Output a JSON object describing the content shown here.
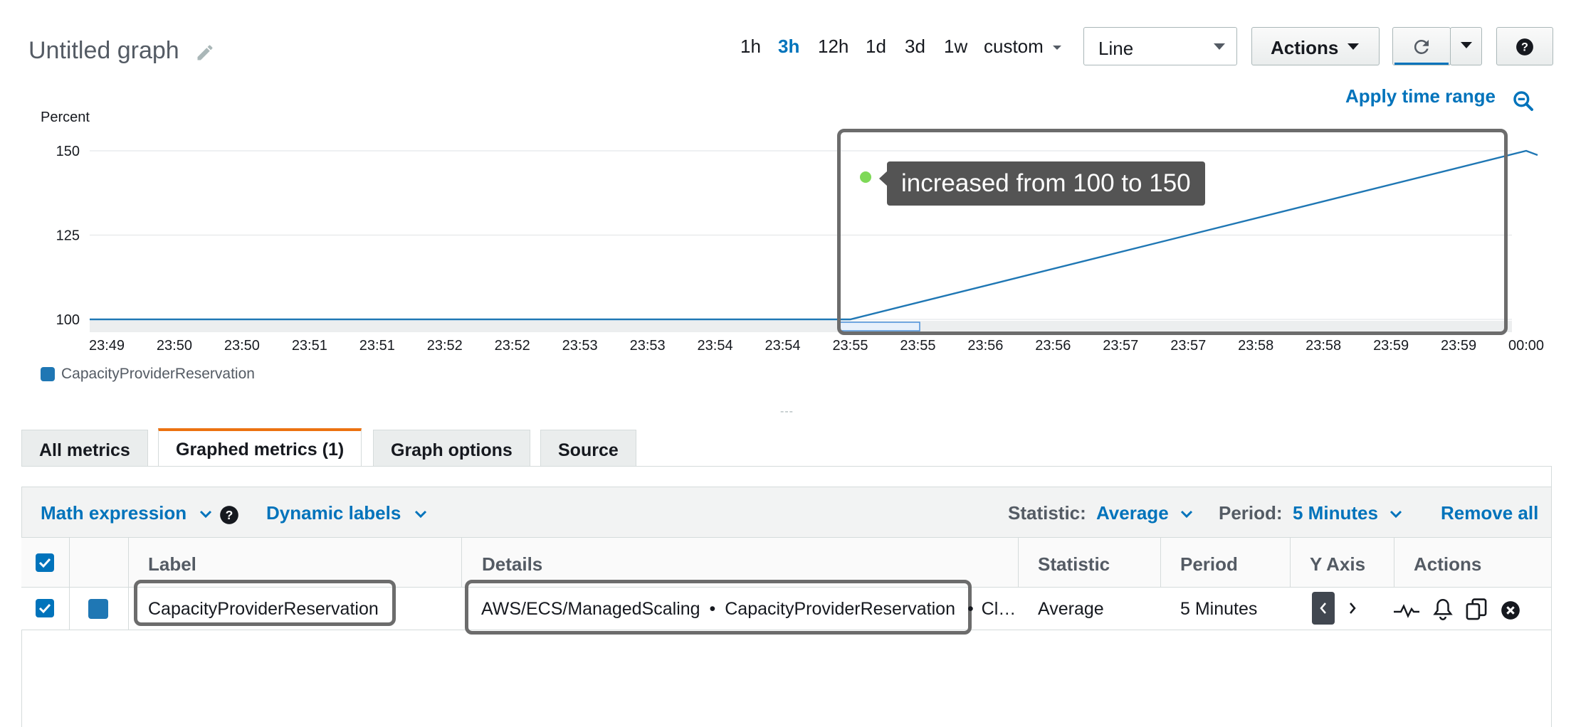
{
  "header": {
    "title": "Untitled graph",
    "time_ranges": [
      {
        "label": "1h",
        "active": false
      },
      {
        "label": "3h",
        "active": true
      },
      {
        "label": "12h",
        "active": false
      },
      {
        "label": "1d",
        "active": false
      },
      {
        "label": "3d",
        "active": false
      },
      {
        "label": "1w",
        "active": false
      }
    ],
    "custom_label": "custom",
    "chart_type_value": "Line",
    "actions_label": "Actions",
    "help_icon": "question-icon",
    "refresh_icon": "refresh-icon"
  },
  "graph": {
    "apply_time_range": "Apply time range",
    "zoom_icon": "zoom-out-icon",
    "annotation_text": "increased from 100 to 150",
    "legend_label": "CapacityProviderReservation",
    "splitter": "---"
  },
  "chart_data": {
    "type": "line",
    "ylabel": "Percent",
    "yticks": [
      100,
      125,
      150
    ],
    "xticks": [
      "23:49",
      "23:50",
      "23:50",
      "23:51",
      "23:51",
      "23:52",
      "23:52",
      "23:53",
      "23:53",
      "23:54",
      "23:54",
      "23:55",
      "23:55",
      "23:56",
      "23:56",
      "23:57",
      "23:57",
      "23:58",
      "23:58",
      "23:59",
      "23:59",
      "00:00"
    ],
    "ylim": [
      100,
      150
    ],
    "series": [
      {
        "name": "CapacityProviderReservation",
        "color": "#1f77b4",
        "points": [
          [
            0,
            100
          ],
          [
            11,
            100
          ],
          [
            21,
            150
          ]
        ]
      }
    ],
    "grid": true
  },
  "tabs": [
    {
      "label": "All metrics",
      "active": false
    },
    {
      "label": "Graphed metrics (1)",
      "active": true
    },
    {
      "label": "Graph options",
      "active": false
    },
    {
      "label": "Source",
      "active": false
    }
  ],
  "toolbar": {
    "math_expression": "Math expression",
    "dynamic_labels": "Dynamic labels",
    "statistic_label": "Statistic:",
    "statistic_value": "Average",
    "period_label": "Period:",
    "period_value": "5 Minutes",
    "remove_all": "Remove all"
  },
  "table": {
    "headers": {
      "label": "Label",
      "details": "Details",
      "statistic": "Statistic",
      "period": "Period",
      "y_axis": "Y Axis",
      "actions": "Actions"
    },
    "rows": [
      {
        "label": "CapacityProviderReservation",
        "details_namespace": "AWS/ECS/ManagedScaling",
        "details_metric": "CapacityProviderReservation",
        "details_rest": "Cl…",
        "statistic": "Average",
        "period": "5 Minutes",
        "color": "#1f77b4"
      }
    ]
  },
  "colors": {
    "accent": "#0073bb",
    "active_tab_border": "#ec7211",
    "series": "#1f77b4",
    "annotation_bg": "#545454"
  }
}
